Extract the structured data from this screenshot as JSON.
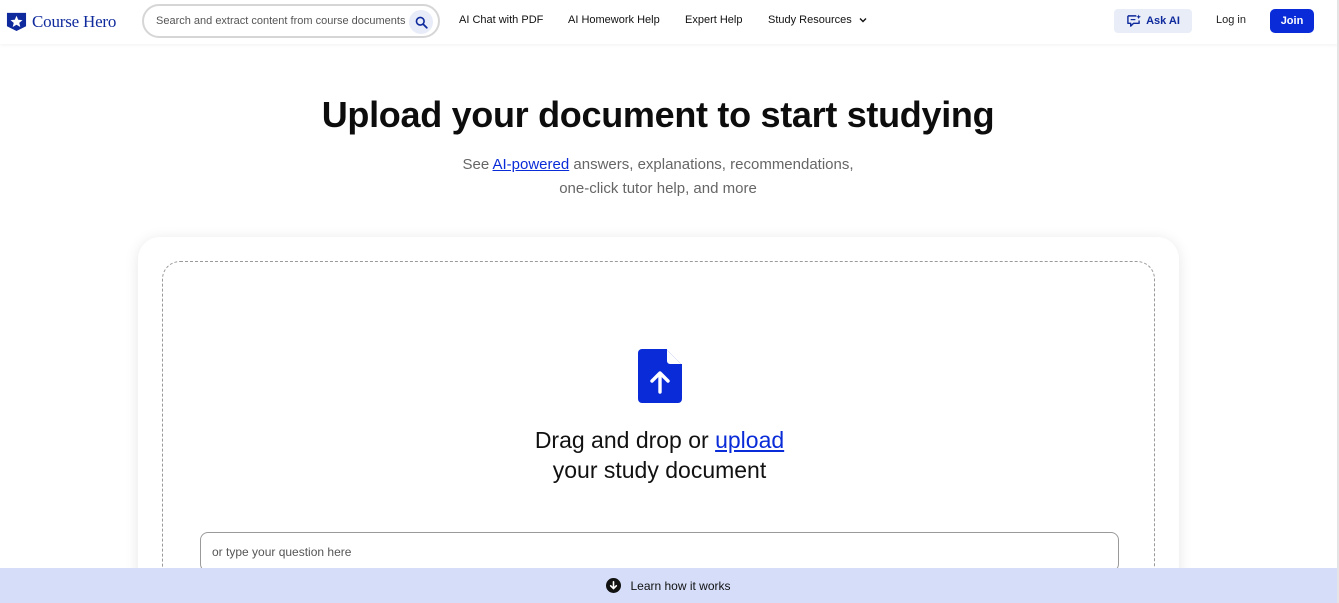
{
  "header": {
    "logo_text": "Course Hero",
    "search": {
      "placeholder": "Search and extract content from course documents, study guides, and more"
    },
    "nav": [
      {
        "label": "AI Chat with PDF"
      },
      {
        "label": "AI Homework Help"
      },
      {
        "label": "Expert Help"
      },
      {
        "label": "Study Resources"
      }
    ],
    "ask_ai_label": "Ask AI",
    "login_label": "Log in",
    "join_label": "Join"
  },
  "hero": {
    "title": "Upload your document to start studying",
    "subtitle_prefix": "See ",
    "subtitle_link": "AI-powered",
    "subtitle_rest": " answers, explanations, recommendations,",
    "subtitle_line2": "one-click tutor help, and more"
  },
  "upload": {
    "drag_prefix": "Drag and drop or ",
    "drag_link": "upload",
    "drag_line2": "your study document",
    "question_placeholder": "or type your question here"
  },
  "footer_bar": {
    "label": "Learn how it works"
  },
  "colors": {
    "brand": "#0a2bd8",
    "logo": "#0f2a9c",
    "learn_bar": "#d5ddf9",
    "ask_ai_bg": "#e8edf8"
  },
  "icons": {
    "logo": "star-icon",
    "search": "search-icon",
    "chevron": "chevron-down-icon",
    "ask_ai": "chat-sparkle-icon",
    "upload": "document-upload-icon",
    "learn": "arrow-down-circle-icon"
  }
}
